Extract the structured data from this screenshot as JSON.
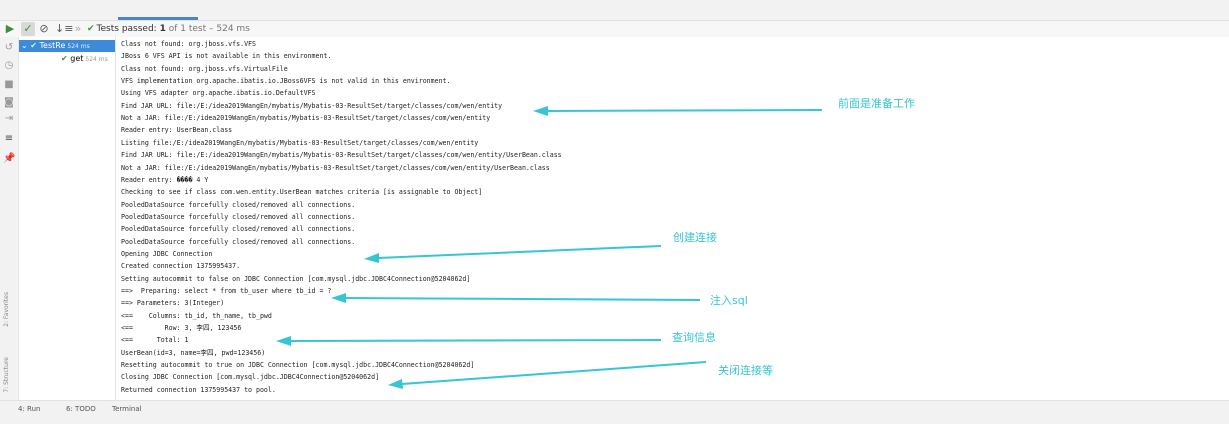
{
  "toolbar": {
    "summary_status": "Tests passed:",
    "summary_count": "1",
    "summary_detail": "of 1 test – 524 ms"
  },
  "tree": {
    "items": [
      {
        "label": "TestRe",
        "time": "524 ms"
      },
      {
        "label": "get",
        "time": "524 ms"
      }
    ]
  },
  "console": {
    "lines": [
      "Class not found: org.jboss.vfs.VFS",
      "JBoss 6 VFS API is not available in this environment.",
      "Class not found: org.jboss.vfs.VirtualFile",
      "VFS implementation org.apache.ibatis.io.JBoss6VFS is not valid in this environment.",
      "Using VFS adapter org.apache.ibatis.io.DefaultVFS",
      "Find JAR URL: file:/E:/idea2019WangEn/mybatis/Mybatis-03-ResultSet/target/classes/com/wen/entity",
      "Not a JAR: file:/E:/idea2019WangEn/mybatis/Mybatis-03-ResultSet/target/classes/com/wen/entity",
      "Reader entry: UserBean.class",
      "Listing file:/E:/idea2019WangEn/mybatis/Mybatis-03-ResultSet/target/classes/com/wen/entity",
      "Find JAR URL: file:/E:/idea2019WangEn/mybatis/Mybatis-03-ResultSet/target/classes/com/wen/entity/UserBean.class",
      "Not a JAR: file:/E:/idea2019WangEn/mybatis/Mybatis-03-ResultSet/target/classes/com/wen/entity/UserBean.class",
      "Reader entry: ���� 4 Y",
      "Checking to see if class com.wen.entity.UserBean matches criteria [is assignable to Object]",
      "PooledDataSource forcefully closed/removed all connections.",
      "PooledDataSource forcefully closed/removed all connections.",
      "PooledDataSource forcefully closed/removed all connections.",
      "PooledDataSource forcefully closed/removed all connections.",
      "Opening JDBC Connection",
      "Created connection 1375995437.",
      "Setting autocommit to false on JDBC Connection [com.mysql.jdbc.JDBC4Connection@5204062d]",
      "==>  Preparing: select * from tb_user where tb_id = ?",
      "==> Parameters: 3(Integer)",
      "<==    Columns: tb_id, th_name, tb_pwd",
      "<==        Row: 3, 李四, 123456",
      "<==      Total: 1",
      "UserBean(id=3, name=李四, pwd=123456)",
      "Resetting autocommit to true on JDBC Connection [com.mysql.jdbc.JDBC4Connection@5204062d]",
      "Closing JDBC Connection [com.mysql.jdbc.JDBC4Connection@5204062d]",
      "Returned connection 1375995437 to pool."
    ]
  },
  "annotations": [
    {
      "text": "前面是准备工作"
    },
    {
      "text": "创建连接"
    },
    {
      "text": "注入sql"
    },
    {
      "text": "查询信息"
    },
    {
      "text": "关闭连接等"
    }
  ],
  "bottom_tabs": [
    "4: Run",
    "6: TODO",
    "Terminal"
  ],
  "colors": {
    "accent_arrow": "#36c5d3",
    "selection": "#3c8bd8",
    "pass_green": "#3e8e3e"
  }
}
